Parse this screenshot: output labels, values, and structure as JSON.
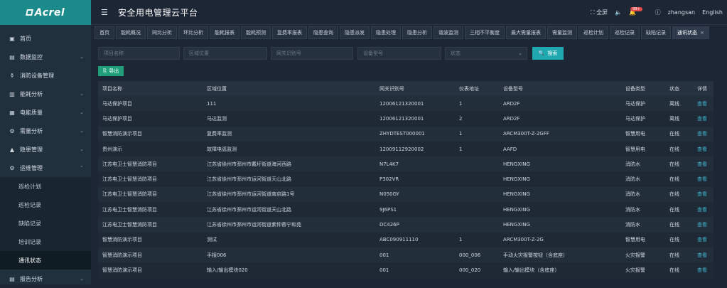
{
  "app": {
    "logo": "Acrel",
    "title": "安全用电管理云平台"
  },
  "topbar": {
    "fullscreen": "全屏",
    "badge": "99+",
    "user": "zhangsan",
    "language": "English"
  },
  "sidebar": {
    "items": [
      {
        "label": "首页",
        "icon": "monitor-icon"
      },
      {
        "label": "数据监控",
        "icon": "chart-icon",
        "chev": "⌄"
      },
      {
        "label": "消防设备管理",
        "icon": "extinguisher-icon"
      },
      {
        "label": "能耗分析",
        "icon": "bar-chart-icon",
        "chev": "⌄"
      },
      {
        "label": "电能质量",
        "icon": "calendar-icon",
        "chev": "⌄"
      },
      {
        "label": "需量分析",
        "icon": "network-icon",
        "chev": "⌄"
      },
      {
        "label": "隐患管理",
        "icon": "warning-icon",
        "chev": "⌄"
      },
      {
        "label": "运维管理",
        "icon": "gear-icon",
        "chev": "⌃"
      }
    ],
    "sub_items": [
      "巡检计划",
      "巡检记录",
      "缺陷记录",
      "培训记录",
      "通讯状态"
    ],
    "bottom_item": {
      "label": "报告分析",
      "icon": "report-icon",
      "chev": "⌄"
    }
  },
  "tabs": [
    "首页",
    "能耗概况",
    "同比分析",
    "环比分析",
    "能耗报表",
    "能耗预测",
    "复费率报表",
    "隐患查询",
    "隐患派发",
    "隐患处理",
    "隐患分析",
    "谐波监测",
    "三相不平衡度",
    "最大需量报表",
    "需量监测",
    "巡检计划",
    "巡检记录",
    "缺陷记录",
    "通讯状态"
  ],
  "filters": {
    "project_name": "项目名称",
    "area": "区域位置",
    "gateway": "网关识别号",
    "device_model": "设备型号",
    "status": "状态",
    "search": "搜索",
    "export": "导出"
  },
  "table": {
    "headers": [
      "项目名称",
      "区域位置",
      "网关识别号",
      "仪表地址",
      "设备型号",
      "设备类型",
      "状态",
      "详情"
    ],
    "rows": [
      [
        "马达保护项目",
        "111",
        "12006121320001",
        "1",
        "ARD2F",
        "马达保护",
        "离线",
        "查看"
      ],
      [
        "马达保护项目",
        "马达监测",
        "12006121320001",
        "2",
        "ARD2F",
        "马达保护",
        "离线",
        "查看"
      ],
      [
        "智慧消防演示项目",
        "复费率监测",
        "ZHYDTEST000001",
        "1",
        "ARCM300T-Z-2GFF",
        "智慧用电",
        "在线",
        "查看"
      ],
      [
        "贵州演示",
        "故障电弧监测",
        "12009112920002",
        "1",
        "AAFD",
        "智慧用电",
        "在线",
        "查看"
      ],
      [
        "江苏电卫士智慧消防项目",
        "江苏省徐州市邳州市戴圩街道海河西路",
        "N7L4K7",
        "",
        "HENGXING",
        "消防水",
        "在线",
        "查看"
      ],
      [
        "江苏电卫士智慧消防项目",
        "江苏省徐州市邳州市运河街道天山北路",
        "P302VR",
        "",
        "HENGXING",
        "消防水",
        "在线",
        "查看"
      ],
      [
        "江苏电卫士智慧消防项目",
        "江苏省徐州市邳州市运河街道南京路1号",
        "N050GY",
        "",
        "HENGXING",
        "消防水",
        "在线",
        "查看"
      ],
      [
        "江苏电卫士智慧消防项目",
        "江苏省徐州市邳州市运河街道天山北路",
        "9J6PS1",
        "",
        "HENGXING",
        "消防水",
        "在线",
        "查看"
      ],
      [
        "江苏电卫士智慧消防项目",
        "江苏省徐州市邳州市运河街道紫仲蓉宁和苑",
        "DC426P",
        "",
        "HENGXING",
        "消防水",
        "在线",
        "查看"
      ],
      [
        "智慧消防演示项目",
        "测试",
        "ABC090911110",
        "1",
        "ARCM300T-Z-2G",
        "智慧用电",
        "在线",
        "查看"
      ],
      [
        "智慧消防演示项目",
        "手报006",
        "001",
        "000_006",
        "手动火灾报警按钮（含底座）",
        "火灾报警",
        "在线",
        "查看"
      ],
      [
        "智慧消防演示项目",
        "输入/输出模块020",
        "001",
        "000_020",
        "输入/输出模块（含底座）",
        "火灾报警",
        "在线",
        "查看"
      ]
    ]
  }
}
